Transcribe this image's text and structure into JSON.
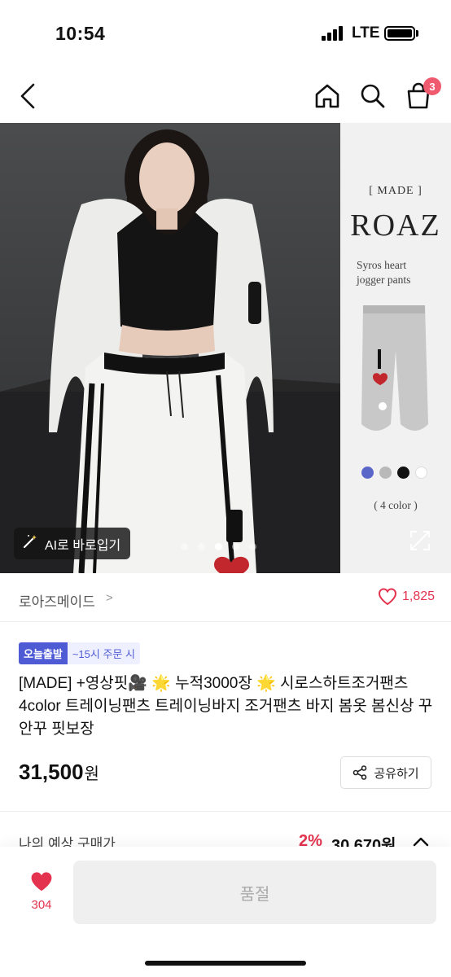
{
  "status": {
    "time": "10:54",
    "network": "LTE"
  },
  "nav": {
    "cart_count": "3"
  },
  "hero": {
    "side": {
      "made": "[ MADE ]",
      "brand": "ROAZ",
      "desc_line1": "Syros heart",
      "desc_line2": "jogger pants",
      "colors": [
        "#5a67c9",
        "#b9b9b9",
        "#111111",
        "#ffffff"
      ],
      "color_count": "( 4 color )"
    },
    "ai_button": "AI로 바로입기",
    "active_slide": 3,
    "slide_count": 6
  },
  "seller": {
    "name": "로아즈메이드",
    "chevron": ">",
    "likes": "1,825"
  },
  "product": {
    "tag_primary": "오늘출발",
    "tag_secondary": "~15시 주문 시",
    "title": "[MADE] +영상핏🎥 🌟 누적3000장 🌟 시로스하트조거팬츠 4color 트레이닝팬츠 트레이닝바지 조거팬츠 바지 봄옷 봄신상 꾸안꾸 핏보장",
    "price": "31,500",
    "price_unit": "원",
    "share_label": "공유하기"
  },
  "estimate": {
    "label": "나의 예상 구매가",
    "discount": "2%",
    "price": "30,670원"
  },
  "bottom": {
    "wish_count": "304",
    "buy_label": "품절"
  },
  "colors": {
    "accent": "#e3334f",
    "tag": "#4f5bd5"
  }
}
